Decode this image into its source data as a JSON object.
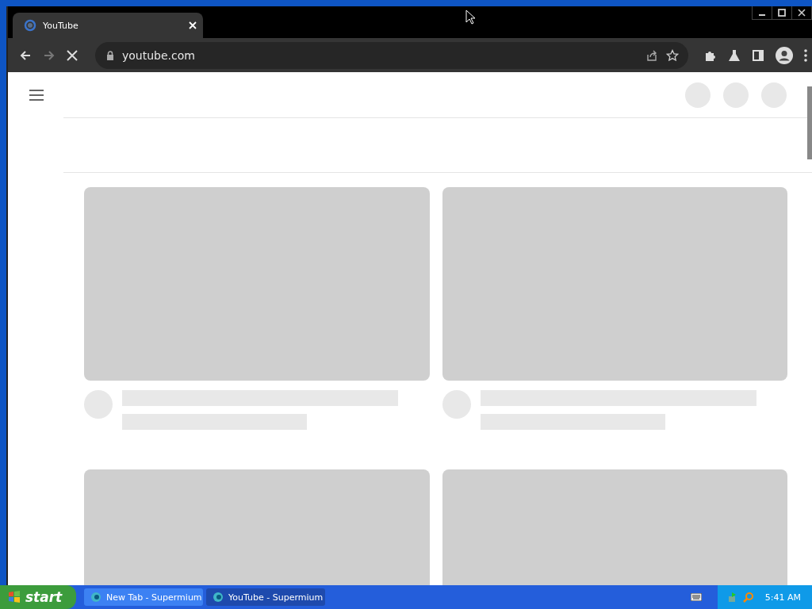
{
  "browser": {
    "tab": {
      "title": "YouTube",
      "selected": true
    },
    "address": "youtube.com",
    "loading": true
  },
  "page": {
    "cards": [
      {
        "kind": "video"
      },
      {
        "kind": "video"
      },
      {
        "kind": "thumbnail"
      },
      {
        "kind": "thumbnail"
      }
    ]
  },
  "taskbar": {
    "start": "start",
    "items": [
      {
        "label": "New Tab - Supermium",
        "selected": false
      },
      {
        "label": "YouTube - Supermium",
        "selected": true
      }
    ],
    "clock": "5:41 AM"
  }
}
